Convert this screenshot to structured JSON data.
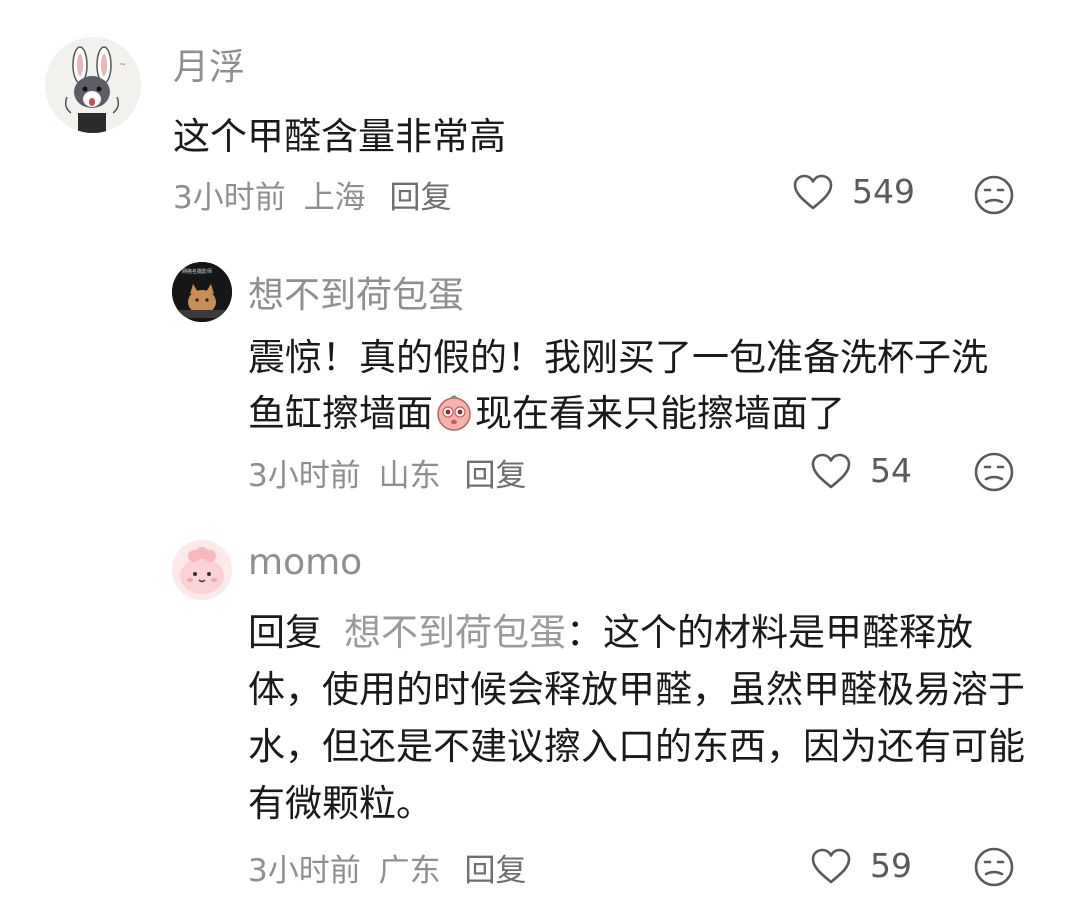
{
  "comments": [
    {
      "username": "月浮",
      "text": "这个甲醛含量非常高",
      "time": "3小时前",
      "location": "上海",
      "reply_label": "回复",
      "likes": "549"
    },
    {
      "username": "想不到荷包蛋",
      "text_part1": "震惊！真的假的！我刚买了一包准备洗杯子洗鱼缸擦墙面",
      "text_part2": "现在看来只能擦墙面了",
      "emoji": "crying-face-emoji",
      "avatar_caption": "网络名摄影师",
      "time": "3小时前",
      "location": "山东",
      "reply_label": "回复",
      "likes": "54"
    },
    {
      "username": "momo",
      "reply_prefix": "回复",
      "reply_target": "想不到荷包蛋",
      "text": "：这个的材料是甲醛释放体，使用的时候会释放甲醛，虽然甲醛极易溶于水，但还是不建议擦入口的东西，因为还有可能有微颗粒。",
      "time": "3小时前",
      "location": "广东",
      "reply_label": "回复",
      "likes": "59"
    }
  ],
  "icons": {
    "like": "heart-outline-icon",
    "dislike": "unhappy-face-icon"
  },
  "colors": {
    "secondary_text": "#8f8f8f",
    "primary_text": "#1a1a1a",
    "icon": "#5a5a5a"
  }
}
